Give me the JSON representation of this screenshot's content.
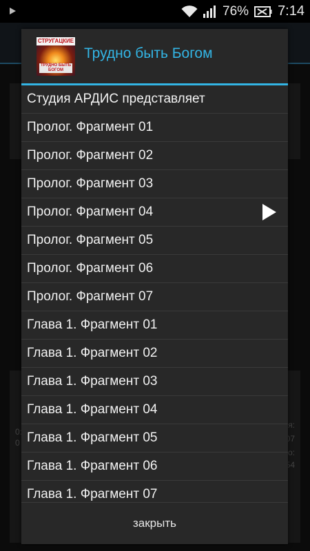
{
  "status_bar": {
    "battery_percent": "76%",
    "time": "7:14",
    "icons": [
      "play-icon",
      "wifi-icon",
      "signal-icon",
      "battery-icon"
    ]
  },
  "background": {
    "fragments": [
      "0:",
      "0",
      "ия:",
      "07",
      "о:",
      "54"
    ]
  },
  "dialog": {
    "cover": {
      "author": "СТРУГАЦКИЕ",
      "title": "ТРУДНО БЫТЬ БОГОМ"
    },
    "title": "Трудно быть Богом",
    "items": [
      {
        "label": "Студия АРДИС представляет",
        "playing": false
      },
      {
        "label": "Пролог. Фрагмент 01",
        "playing": false
      },
      {
        "label": "Пролог. Фрагмент 02",
        "playing": false
      },
      {
        "label": "Пролог. Фрагмент 03",
        "playing": false
      },
      {
        "label": "Пролог. Фрагмент 04",
        "playing": true
      },
      {
        "label": "Пролог. Фрагмент 05",
        "playing": false
      },
      {
        "label": "Пролог. Фрагмент 06",
        "playing": false
      },
      {
        "label": "Пролог. Фрагмент 07",
        "playing": false
      },
      {
        "label": "Глава 1. Фрагмент 01",
        "playing": false
      },
      {
        "label": "Глава 1. Фрагмент 02",
        "playing": false
      },
      {
        "label": "Глава 1. Фрагмент 03",
        "playing": false
      },
      {
        "label": "Глава 1. Фрагмент 04",
        "playing": false
      },
      {
        "label": "Глава 1. Фрагмент 05",
        "playing": false
      },
      {
        "label": "Глава 1. Фрагмент 06",
        "playing": false
      },
      {
        "label": "Глава 1. Фрагмент 07",
        "playing": false
      }
    ],
    "close_label": "закрыть"
  },
  "colors": {
    "accent": "#33b5e5",
    "dialog_bg": "#282828",
    "divider": "#3a3a3a"
  }
}
